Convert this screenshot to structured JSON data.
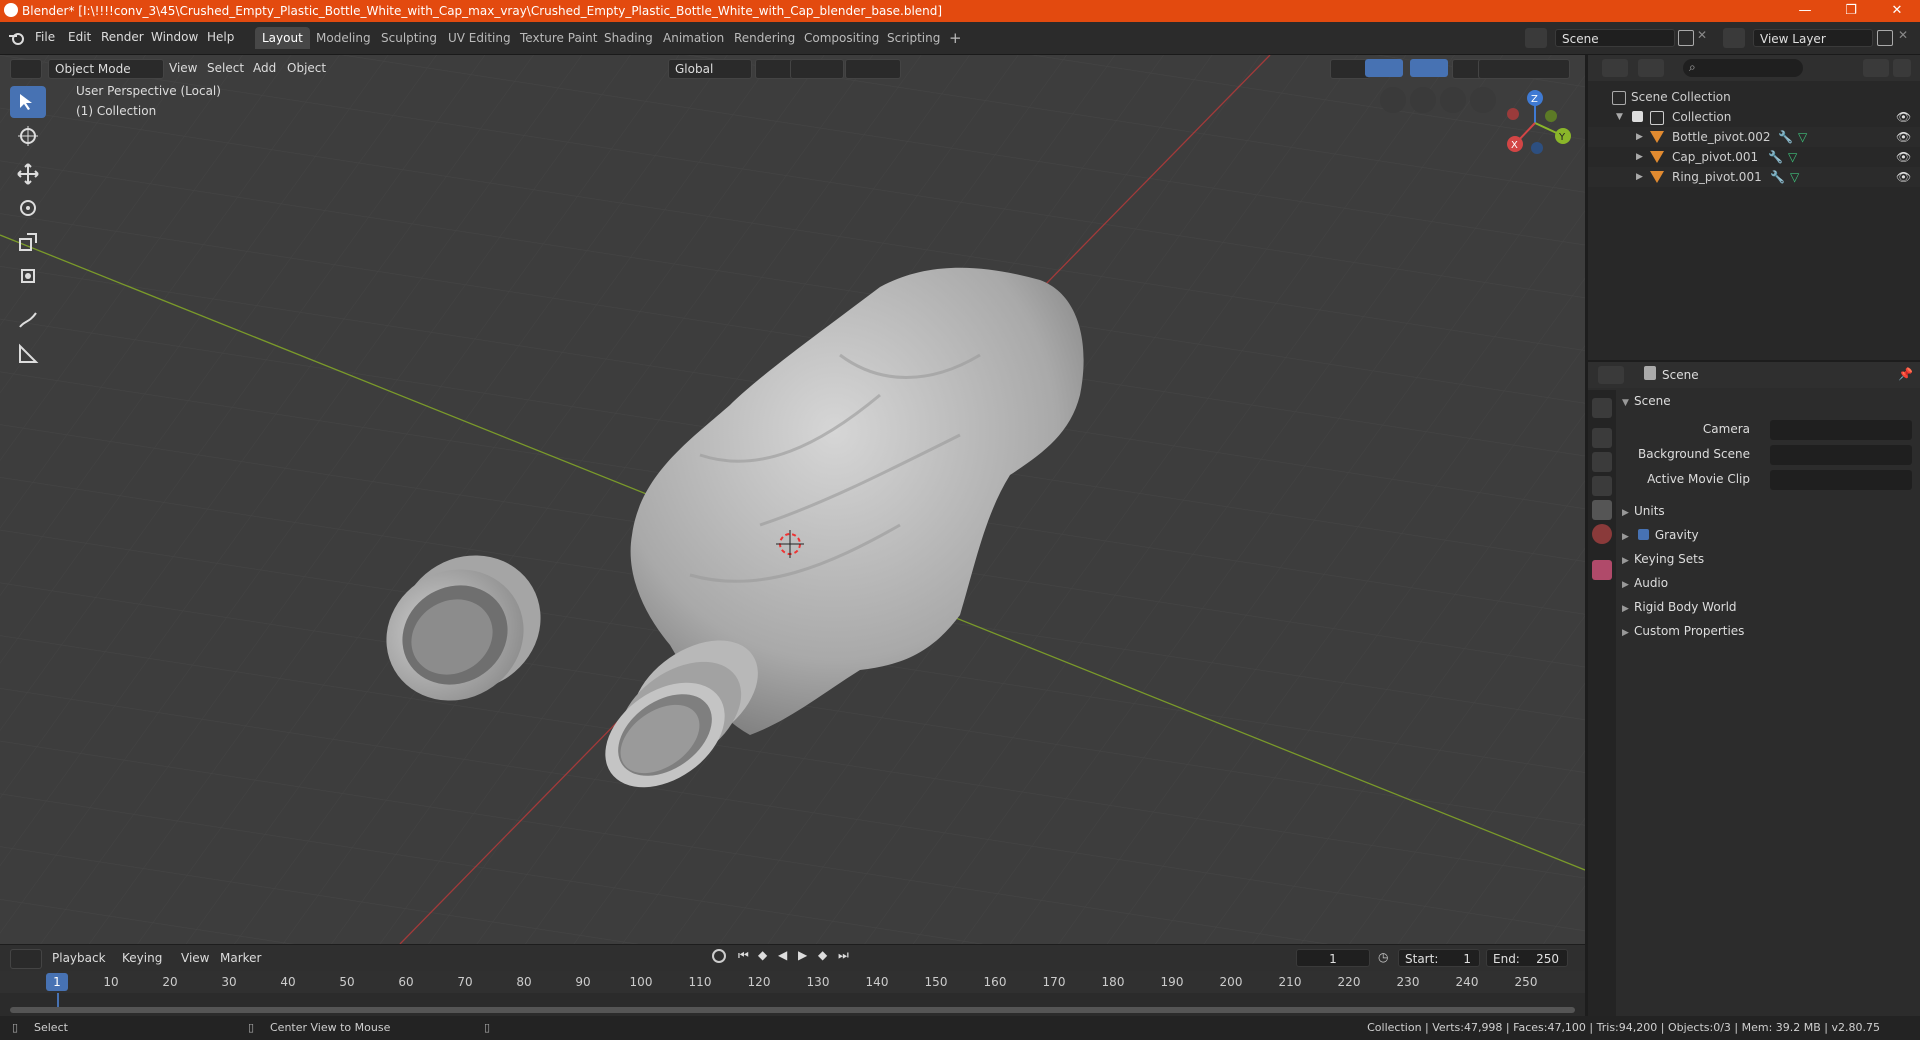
{
  "window": {
    "title": "Blender* [I:\\!!!!conv_3\\45\\Crushed_Empty_Plastic_Bottle_White_with_Cap_max_vray\\Crushed_Empty_Plastic_Bottle_White_with_Cap_blender_base.blend]",
    "minimize": "—",
    "maximize": "❐",
    "close": "✕"
  },
  "menu": [
    "File",
    "Edit",
    "Render",
    "Window",
    "Help"
  ],
  "workspaces": [
    "Layout",
    "Modeling",
    "Sculpting",
    "UV Editing",
    "Texture Paint",
    "Shading",
    "Animation",
    "Rendering",
    "Compositing",
    "Scripting"
  ],
  "workspace_add": "+",
  "scene_field": "Scene",
  "view_layer_field": "View Layer",
  "viewport": {
    "mode": "Object Mode",
    "menus": [
      "View",
      "Select",
      "Add",
      "Object"
    ],
    "orientation": "Global",
    "overlay_title": "User Perspective (Local)",
    "overlay_collection": "(1) Collection",
    "gizmo_axes": {
      "x": "X",
      "y": "Y",
      "z": "Z"
    },
    "colors": {
      "x_axis": "#b83a3a",
      "y_axis": "#8ab62a",
      "bg": "#3d3d3d",
      "grid": "#444444"
    }
  },
  "outliner": {
    "root": "Scene Collection",
    "collection": "Collection",
    "objects": [
      "Bottle_pivot.002",
      "Cap_pivot.001",
      "Ring_pivot.001"
    ]
  },
  "properties": {
    "header": "Scene",
    "panel": "Scene",
    "fields": {
      "camera": "Camera",
      "background_scene": "Background Scene",
      "active_movie_clip": "Active Movie Clip"
    },
    "sections": [
      "Units",
      "Gravity",
      "Keying Sets",
      "Audio",
      "Rigid Body World",
      "Custom Properties"
    ]
  },
  "timeline": {
    "menus": [
      "Playback",
      "Keying",
      "View",
      "Marker"
    ],
    "current_frame": "1",
    "start_label": "Start:",
    "start": "1",
    "end_label": "End:",
    "end": "250",
    "ticks": [
      "1",
      "10",
      "20",
      "30",
      "40",
      "50",
      "60",
      "70",
      "80",
      "90",
      "100",
      "110",
      "120",
      "130",
      "140",
      "150",
      "160",
      "170",
      "180",
      "190",
      "200",
      "210",
      "220",
      "230",
      "240",
      "250"
    ]
  },
  "status": {
    "select": "Select",
    "center_view": "Center View to Mouse",
    "stats": "Collection | Verts:47,998 | Faces:47,100 | Tris:94,200 | Objects:0/3 | Mem: 39.2 MB | v2.80.75"
  }
}
